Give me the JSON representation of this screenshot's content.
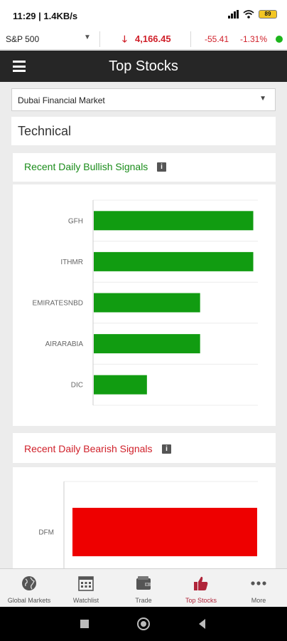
{
  "status_bar": {
    "time": "11:29",
    "net": "1.4KB/s",
    "battery": "89"
  },
  "ticker": {
    "symbol": "S&P 500",
    "price": "4,166.45",
    "change": "-55.41",
    "change_pct": "-1.31%",
    "direction": "down",
    "live_color": "#1cb51c"
  },
  "header": {
    "title": "Top Stocks",
    "menu_icon": "hamburger-icon"
  },
  "market_select": {
    "value": "Dubai Financial Market"
  },
  "section": {
    "title": "Technical"
  },
  "bullish": {
    "title": "Recent Daily Bullish Signals",
    "color": "#1a8c1a",
    "chart_data": {
      "type": "bar",
      "orientation": "horizontal",
      "categories": [
        "GFH",
        "ITHMR",
        "EMIRATESNBD",
        "AIRARABIA",
        "DIC"
      ],
      "values": [
        6,
        6,
        4,
        4,
        2
      ],
      "bar_color": "#119c11",
      "xlim": [
        0,
        6.2
      ],
      "grid": true
    }
  },
  "bearish": {
    "title": "Recent Daily Bearish Signals",
    "color": "#d0202a",
    "chart_data": {
      "type": "bar",
      "orientation": "horizontal",
      "categories": [
        "DFM"
      ],
      "values": [
        1
      ],
      "bar_color": "#ee0000",
      "xlim": [
        0,
        1.05
      ],
      "grid": true
    }
  },
  "nav": {
    "items": [
      {
        "label": "Global Markets",
        "icon": "globe-icon",
        "active": false
      },
      {
        "label": "Watchlist",
        "icon": "calendar-icon",
        "active": false
      },
      {
        "label": "Trade",
        "icon": "wallet-icon",
        "active": false
      },
      {
        "label": "Top Stocks",
        "icon": "thumbs-up-icon",
        "active": true
      },
      {
        "label": "More",
        "icon": "more-icon",
        "active": false
      }
    ]
  }
}
